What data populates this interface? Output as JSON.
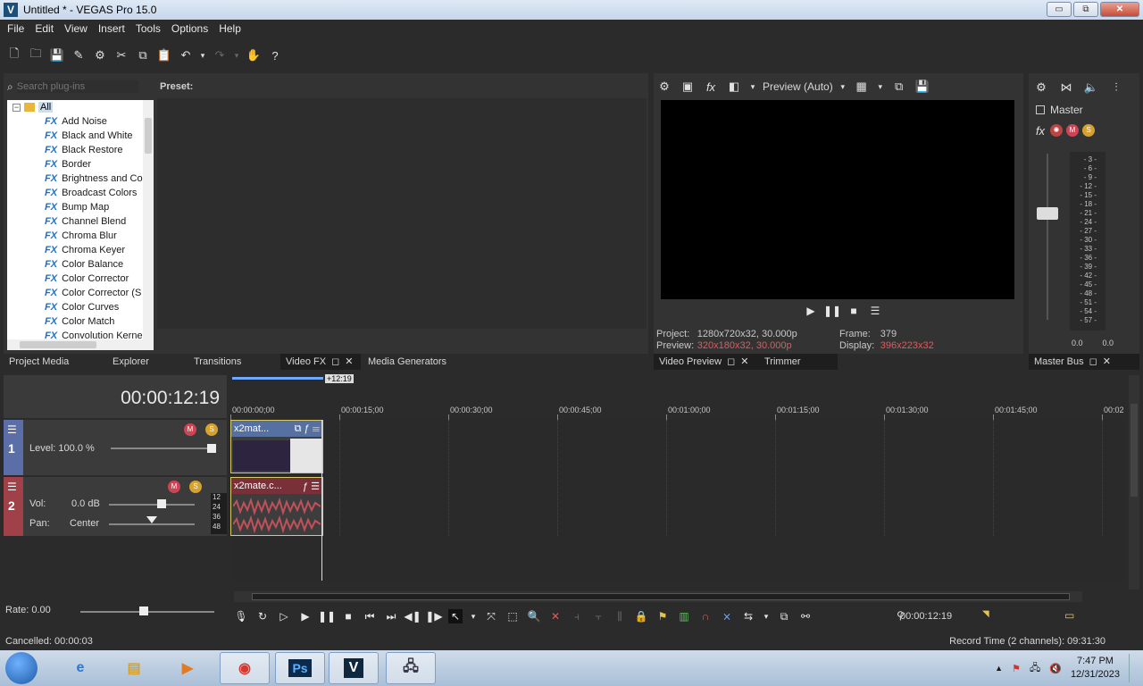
{
  "window": {
    "title": "Untitled * - VEGAS Pro 15.0",
    "app_icon_letter": "V",
    "controls": {
      "minimize": "▭",
      "restore": "⧉",
      "close": "✕"
    }
  },
  "menu": [
    "File",
    "Edit",
    "View",
    "Insert",
    "Tools",
    "Options",
    "Help"
  ],
  "toolbar": {
    "icons": [
      "new-icon",
      "open-icon",
      "save-icon",
      "save-as-icon",
      "properties-icon",
      "cut-icon",
      "copy-icon",
      "paste-icon",
      "undo-icon",
      "redo-icon",
      "hand-icon",
      "help-icon"
    ]
  },
  "fx_panel": {
    "search_placeholder": "Search plug-ins",
    "preset_label": "Preset:",
    "root_label": "All",
    "fx_badge": "FX",
    "items": [
      "Add Noise",
      "Black and White",
      "Black Restore",
      "Border",
      "Brightness and Co",
      "Broadcast Colors",
      "Bump Map",
      "Channel Blend",
      "Chroma Blur",
      "Chroma Keyer",
      "Color Balance",
      "Color Corrector",
      "Color Corrector (S",
      "Color Curves",
      "Color Match",
      "Convolution Kernel"
    ]
  },
  "preview": {
    "mode": "Preview (Auto)",
    "project_label": "Project:",
    "project_value": "1280x720x32, 30.000p",
    "preview_label": "Preview:",
    "preview_value": "320x180x32, 30.000p",
    "frame_label": "Frame:",
    "frame_value": "379",
    "display_label": "Display:",
    "display_value": "396x223x32"
  },
  "master": {
    "label": "Master",
    "meter_ticks": [
      "3",
      "6",
      "9",
      "12",
      "15",
      "18",
      "21",
      "24",
      "27",
      "30",
      "33",
      "36",
      "39",
      "42",
      "45",
      "48",
      "51",
      "54",
      "57"
    ],
    "level_left": "0.0",
    "level_right": "0.0"
  },
  "dock_tabs": {
    "project_media": "Project Media",
    "explorer": "Explorer",
    "transitions": "Transitions",
    "video_fx": "Video FX",
    "media_generators": "Media Generators",
    "video_preview": "Video Preview",
    "trimmer": "Trimmer",
    "master_bus": "Master Bus"
  },
  "timeline": {
    "timecode": "00:00:12:19",
    "region_label": "+12:19",
    "ruler": [
      "00:00:00;00",
      "00:00:15;00",
      "00:00:30;00",
      "00:00:45;00",
      "00:01:00;00",
      "00:01:15;00",
      "00:01:30;00",
      "00:01:45;00",
      "00:02"
    ],
    "track1": {
      "number": "1",
      "level_label": "Level: 100.0 %",
      "level": 1.0
    },
    "track2": {
      "number": "2",
      "vol_label": "Vol:",
      "vol_value": "0.0 dB",
      "pan_label": "Pan:",
      "pan_value": "Center",
      "meter_labels": [
        "12",
        "24",
        "36",
        "48"
      ]
    },
    "clips": {
      "video_name": "x2mat...",
      "audio_name": "x2mate.c..."
    },
    "rate_label": "Rate: 0.00",
    "cursor_time": "00:00:12:19"
  },
  "status": {
    "left": "Cancelled: 00:00:03",
    "right": "Record Time (2 channels): 09:31:30"
  },
  "taskbar": {
    "time": "7:47 PM",
    "date": "12/31/2023",
    "apps": [
      "internet-explorer-icon",
      "file-explorer-icon",
      "media-player-icon",
      "chrome-icon",
      "photoshop-icon",
      "vegas-icon",
      "network-icon"
    ],
    "vegas_letter": "V",
    "photoshop_letters": "Ps"
  }
}
